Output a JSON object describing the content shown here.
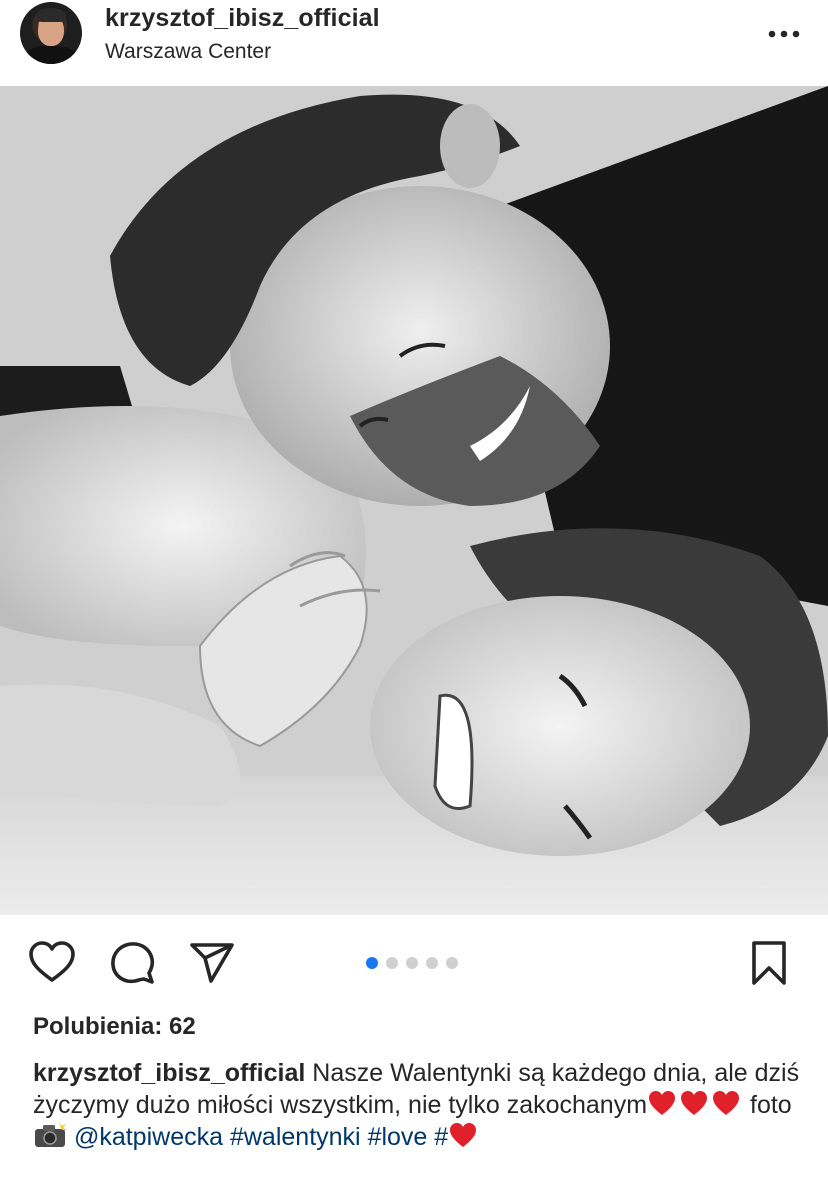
{
  "header": {
    "username": "krzysztof_ibisz_official",
    "location": "Warszawa Center"
  },
  "post": {
    "carousel": {
      "total": 5,
      "active": 1
    },
    "likes_text": "Polubienia: 62"
  },
  "caption": {
    "username": "krzysztof_ibisz_official",
    "text_part1": " Nasze Walentynki są każdego dnia, ale dziś życzymy dużo miłości wszystkim, nie tylko zakochanym",
    "text_foto": " foto",
    "mention": "@katpiwecka",
    "hashtag_1": "#walentynki",
    "hashtag_2": "#love",
    "hashtag_3": "#"
  },
  "colors": {
    "link": "#00376b",
    "carousel_active": "#1877f2",
    "carousel_inactive": "#d0d0d0",
    "heart_emoji": "#e0202a"
  },
  "icons": [
    "more-horizontal-icon",
    "heart-outline-icon",
    "comment-icon",
    "send-icon",
    "bookmark-icon",
    "red-heart-emoji-icon",
    "camera-flash-emoji-icon"
  ]
}
